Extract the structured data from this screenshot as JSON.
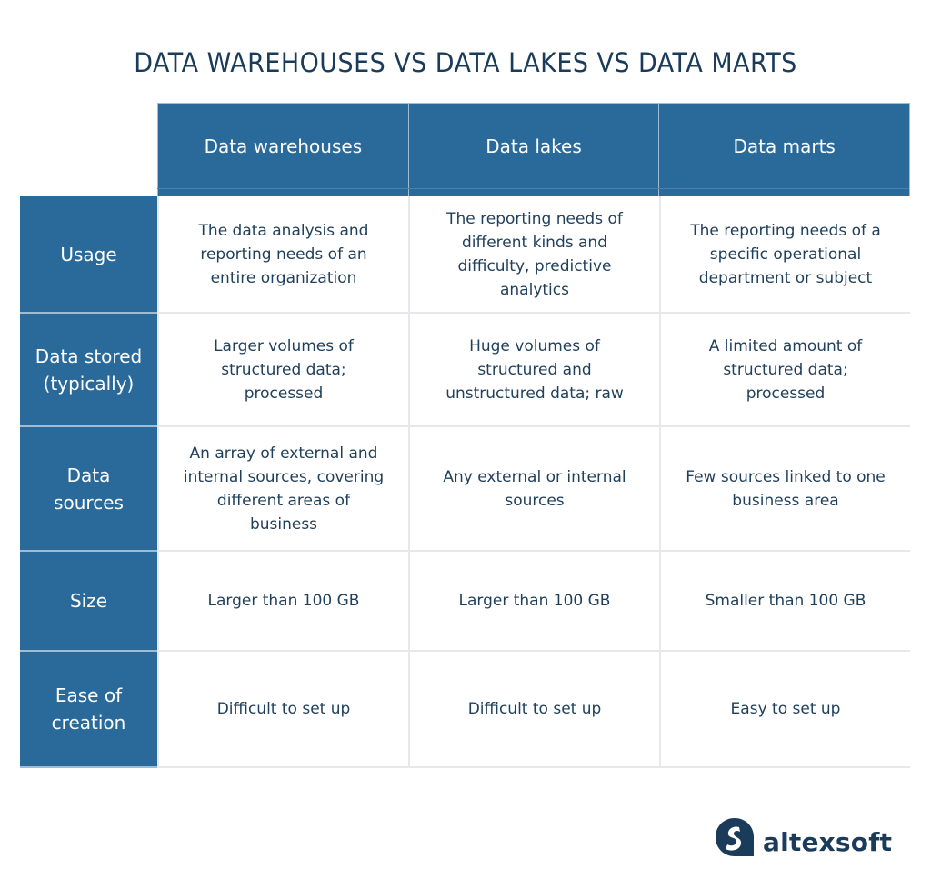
{
  "title": "DATA WAREHOUSES VS DATA LAKES VS DATA MARTS",
  "columns": [
    "Data warehouses",
    "Data lakes",
    "Data marts"
  ],
  "rows": [
    {
      "label": "Usage",
      "cells": [
        "The data analysis and\nreporting needs of an\nentire organization",
        "The reporting needs of\ndifferent kinds and\ndifficulty, predictive\nanalytics",
        "The reporting needs of a\nspecific operational\ndepartment or subject"
      ]
    },
    {
      "label": "Data stored\n(typically)",
      "cells": [
        "Larger volumes of\nstructured data;\nprocessed",
        "Huge volumes of\nstructured and\nunstructured data; raw",
        "A limited amount of\nstructured data;\nprocessed"
      ]
    },
    {
      "label": "Data\nsources",
      "cells": [
        "An array of external and\ninternal sources, covering\ndifferent areas of\nbusiness",
        "Any external or internal\nsources",
        "Few sources linked to one\nbusiness area"
      ]
    },
    {
      "label": "Size",
      "cells": [
        "Larger than 100 GB",
        "Larger than 100 GB",
        "Smaller than 100 GB"
      ]
    },
    {
      "label": "Ease of\ncreation",
      "cells": [
        "Difficult to set up",
        "Difficult to set up",
        "Easy to set up"
      ]
    }
  ],
  "logo": {
    "text": "altexsoft",
    "icon": "altexsoft-logo-icon"
  },
  "colors": {
    "header_bg": "#2a6a9b",
    "title": "#1a3c5a",
    "text": "#1f3f5b",
    "grid": "#e6e8eb"
  }
}
